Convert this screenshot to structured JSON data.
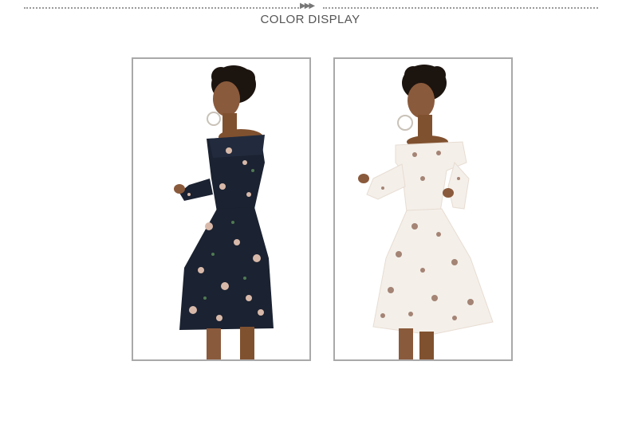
{
  "header": {
    "title": "COLOR DISPLAY"
  },
  "photos": [
    {
      "variant": "dark navy floral off-shoulder dress",
      "dress_color": "#1b2231"
    },
    {
      "variant": "white floral off-shoulder dress",
      "dress_color": "#f4efe9"
    }
  ],
  "colors": {
    "frame": "#a9a9a9",
    "divider": "#9a9a9a",
    "title_text": "#555555"
  }
}
